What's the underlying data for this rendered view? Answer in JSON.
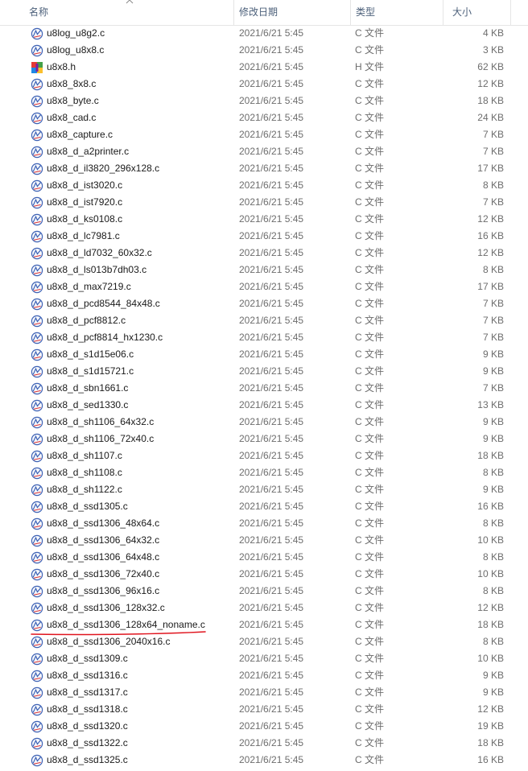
{
  "columns": {
    "name": "名称",
    "date": "修改日期",
    "type": "类型",
    "size": "大小"
  },
  "files": [
    {
      "name": "u8log_u8g2.c",
      "date": "2021/6/21 5:45",
      "type": "C 文件",
      "size": "4 KB",
      "icon": "c-source-file-icon"
    },
    {
      "name": "u8log_u8x8.c",
      "date": "2021/6/21 5:45",
      "type": "C 文件",
      "size": "3 KB",
      "icon": "c-source-file-icon"
    },
    {
      "name": "u8x8.h",
      "date": "2021/6/21 5:45",
      "type": "H 文件",
      "size": "62 KB",
      "icon": "h-header-file-icon"
    },
    {
      "name": "u8x8_8x8.c",
      "date": "2021/6/21 5:45",
      "type": "C 文件",
      "size": "12 KB",
      "icon": "c-source-file-icon"
    },
    {
      "name": "u8x8_byte.c",
      "date": "2021/6/21 5:45",
      "type": "C 文件",
      "size": "18 KB",
      "icon": "c-source-file-icon"
    },
    {
      "name": "u8x8_cad.c",
      "date": "2021/6/21 5:45",
      "type": "C 文件",
      "size": "24 KB",
      "icon": "c-source-file-icon"
    },
    {
      "name": "u8x8_capture.c",
      "date": "2021/6/21 5:45",
      "type": "C 文件",
      "size": "7 KB",
      "icon": "c-source-file-icon"
    },
    {
      "name": "u8x8_d_a2printer.c",
      "date": "2021/6/21 5:45",
      "type": "C 文件",
      "size": "7 KB",
      "icon": "c-source-file-icon"
    },
    {
      "name": "u8x8_d_il3820_296x128.c",
      "date": "2021/6/21 5:45",
      "type": "C 文件",
      "size": "17 KB",
      "icon": "c-source-file-icon"
    },
    {
      "name": "u8x8_d_ist3020.c",
      "date": "2021/6/21 5:45",
      "type": "C 文件",
      "size": "8 KB",
      "icon": "c-source-file-icon"
    },
    {
      "name": "u8x8_d_ist7920.c",
      "date": "2021/6/21 5:45",
      "type": "C 文件",
      "size": "7 KB",
      "icon": "c-source-file-icon"
    },
    {
      "name": "u8x8_d_ks0108.c",
      "date": "2021/6/21 5:45",
      "type": "C 文件",
      "size": "12 KB",
      "icon": "c-source-file-icon"
    },
    {
      "name": "u8x8_d_lc7981.c",
      "date": "2021/6/21 5:45",
      "type": "C 文件",
      "size": "16 KB",
      "icon": "c-source-file-icon"
    },
    {
      "name": "u8x8_d_ld7032_60x32.c",
      "date": "2021/6/21 5:45",
      "type": "C 文件",
      "size": "12 KB",
      "icon": "c-source-file-icon"
    },
    {
      "name": "u8x8_d_ls013b7dh03.c",
      "date": "2021/6/21 5:45",
      "type": "C 文件",
      "size": "8 KB",
      "icon": "c-source-file-icon"
    },
    {
      "name": "u8x8_d_max7219.c",
      "date": "2021/6/21 5:45",
      "type": "C 文件",
      "size": "17 KB",
      "icon": "c-source-file-icon"
    },
    {
      "name": "u8x8_d_pcd8544_84x48.c",
      "date": "2021/6/21 5:45",
      "type": "C 文件",
      "size": "7 KB",
      "icon": "c-source-file-icon"
    },
    {
      "name": "u8x8_d_pcf8812.c",
      "date": "2021/6/21 5:45",
      "type": "C 文件",
      "size": "7 KB",
      "icon": "c-source-file-icon"
    },
    {
      "name": "u8x8_d_pcf8814_hx1230.c",
      "date": "2021/6/21 5:45",
      "type": "C 文件",
      "size": "7 KB",
      "icon": "c-source-file-icon"
    },
    {
      "name": "u8x8_d_s1d15e06.c",
      "date": "2021/6/21 5:45",
      "type": "C 文件",
      "size": "9 KB",
      "icon": "c-source-file-icon"
    },
    {
      "name": "u8x8_d_s1d15721.c",
      "date": "2021/6/21 5:45",
      "type": "C 文件",
      "size": "9 KB",
      "icon": "c-source-file-icon"
    },
    {
      "name": "u8x8_d_sbn1661.c",
      "date": "2021/6/21 5:45",
      "type": "C 文件",
      "size": "7 KB",
      "icon": "c-source-file-icon"
    },
    {
      "name": "u8x8_d_sed1330.c",
      "date": "2021/6/21 5:45",
      "type": "C 文件",
      "size": "13 KB",
      "icon": "c-source-file-icon"
    },
    {
      "name": "u8x8_d_sh1106_64x32.c",
      "date": "2021/6/21 5:45",
      "type": "C 文件",
      "size": "9 KB",
      "icon": "c-source-file-icon"
    },
    {
      "name": "u8x8_d_sh1106_72x40.c",
      "date": "2021/6/21 5:45",
      "type": "C 文件",
      "size": "9 KB",
      "icon": "c-source-file-icon"
    },
    {
      "name": "u8x8_d_sh1107.c",
      "date": "2021/6/21 5:45",
      "type": "C 文件",
      "size": "18 KB",
      "icon": "c-source-file-icon"
    },
    {
      "name": "u8x8_d_sh1108.c",
      "date": "2021/6/21 5:45",
      "type": "C 文件",
      "size": "8 KB",
      "icon": "c-source-file-icon"
    },
    {
      "name": "u8x8_d_sh1122.c",
      "date": "2021/6/21 5:45",
      "type": "C 文件",
      "size": "9 KB",
      "icon": "c-source-file-icon"
    },
    {
      "name": "u8x8_d_ssd1305.c",
      "date": "2021/6/21 5:45",
      "type": "C 文件",
      "size": "16 KB",
      "icon": "c-source-file-icon"
    },
    {
      "name": "u8x8_d_ssd1306_48x64.c",
      "date": "2021/6/21 5:45",
      "type": "C 文件",
      "size": "8 KB",
      "icon": "c-source-file-icon"
    },
    {
      "name": "u8x8_d_ssd1306_64x32.c",
      "date": "2021/6/21 5:45",
      "type": "C 文件",
      "size": "10 KB",
      "icon": "c-source-file-icon"
    },
    {
      "name": "u8x8_d_ssd1306_64x48.c",
      "date": "2021/6/21 5:45",
      "type": "C 文件",
      "size": "8 KB",
      "icon": "c-source-file-icon"
    },
    {
      "name": "u8x8_d_ssd1306_72x40.c",
      "date": "2021/6/21 5:45",
      "type": "C 文件",
      "size": "10 KB",
      "icon": "c-source-file-icon"
    },
    {
      "name": "u8x8_d_ssd1306_96x16.c",
      "date": "2021/6/21 5:45",
      "type": "C 文件",
      "size": "8 KB",
      "icon": "c-source-file-icon"
    },
    {
      "name": "u8x8_d_ssd1306_128x32.c",
      "date": "2021/6/21 5:45",
      "type": "C 文件",
      "size": "12 KB",
      "icon": "c-source-file-icon"
    },
    {
      "name": "u8x8_d_ssd1306_128x64_noname.c",
      "date": "2021/6/21 5:45",
      "type": "C 文件",
      "size": "18 KB",
      "icon": "c-source-file-icon",
      "highlighted": true
    },
    {
      "name": "u8x8_d_ssd1306_2040x16.c",
      "date": "2021/6/21 5:45",
      "type": "C 文件",
      "size": "8 KB",
      "icon": "c-source-file-icon"
    },
    {
      "name": "u8x8_d_ssd1309.c",
      "date": "2021/6/21 5:45",
      "type": "C 文件",
      "size": "10 KB",
      "icon": "c-source-file-icon"
    },
    {
      "name": "u8x8_d_ssd1316.c",
      "date": "2021/6/21 5:45",
      "type": "C 文件",
      "size": "9 KB",
      "icon": "c-source-file-icon"
    },
    {
      "name": "u8x8_d_ssd1317.c",
      "date": "2021/6/21 5:45",
      "type": "C 文件",
      "size": "9 KB",
      "icon": "c-source-file-icon"
    },
    {
      "name": "u8x8_d_ssd1318.c",
      "date": "2021/6/21 5:45",
      "type": "C 文件",
      "size": "12 KB",
      "icon": "c-source-file-icon"
    },
    {
      "name": "u8x8_d_ssd1320.c",
      "date": "2021/6/21 5:45",
      "type": "C 文件",
      "size": "19 KB",
      "icon": "c-source-file-icon"
    },
    {
      "name": "u8x8_d_ssd1322.c",
      "date": "2021/6/21 5:45",
      "type": "C 文件",
      "size": "18 KB",
      "icon": "c-source-file-icon"
    },
    {
      "name": "u8x8_d_ssd1325.c",
      "date": "2021/6/21 5:45",
      "type": "C 文件",
      "size": "16 KB",
      "icon": "c-source-file-icon"
    }
  ],
  "colors": {
    "header_text": "#4c607a",
    "secondary_text": "#6d6d6d",
    "annotation_red": "#e0141e"
  }
}
